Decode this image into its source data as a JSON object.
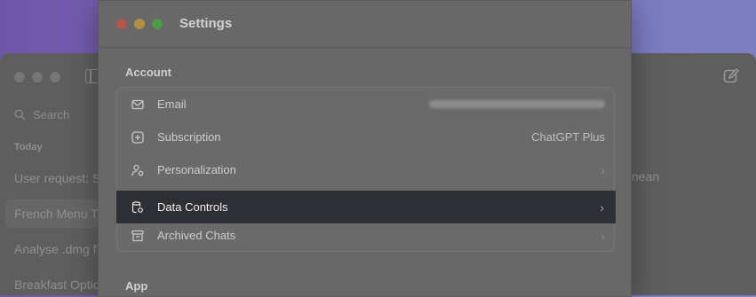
{
  "background_window": {
    "search_placeholder": "Search",
    "section_today": "Today",
    "items": [
      "User request: S",
      "French Menu T",
      "Analyse .dmg f",
      "Breakfast Optic"
    ],
    "side_text": "nean"
  },
  "settings": {
    "title": "Settings",
    "account_label": "Account",
    "app_label": "App",
    "rows": [
      {
        "label": "Email",
        "value": "",
        "icon": "mail-icon"
      },
      {
        "label": "Subscription",
        "value": "ChatGPT Plus",
        "icon": "plus-square-icon"
      },
      {
        "label": "Personalization",
        "value": "",
        "icon": "person-settings-icon"
      },
      {
        "label": "Data Controls",
        "value": "",
        "icon": "database-settings-icon"
      },
      {
        "label": "Archived Chats",
        "value": "",
        "icon": "archive-box-icon"
      }
    ]
  },
  "colors": {
    "highlight_row": "#2e2f35",
    "traffic_red": "#b5534d",
    "traffic_yellow": "#b38f3f",
    "traffic_green": "#4f9a49"
  }
}
